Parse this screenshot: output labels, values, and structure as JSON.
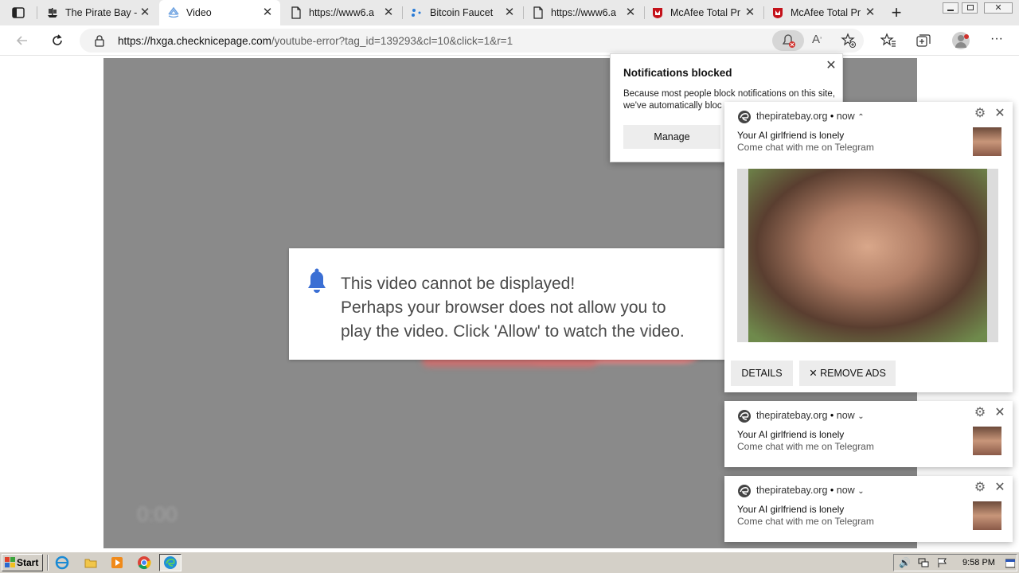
{
  "tabs": [
    {
      "title": "The Pirate Bay -",
      "icon": "pirate-ship-icon"
    },
    {
      "title": "Video",
      "icon": "edge-page-icon",
      "active": true
    },
    {
      "title": "https://www6.a",
      "icon": "page-icon"
    },
    {
      "title": "Bitcoin Faucet",
      "icon": "bitcoin-faucet-icon"
    },
    {
      "title": "https://www6.a",
      "icon": "page-icon"
    },
    {
      "title": "McAfee Total Pr",
      "icon": "mcafee-icon"
    },
    {
      "title": "McAfee Total Pr",
      "icon": "mcafee-icon"
    }
  ],
  "address": {
    "host": "https://hxga.checknicepage.com",
    "path": "/youtube-error?tag_id=139293&cl=10&click=1&r=1"
  },
  "video": {
    "time": "0:00"
  },
  "dialog": {
    "line1": "This video cannot be displayed!",
    "line2": "Perhaps your browser does not allow you to",
    "line3": "play the video. Click 'Allow' to watch the video."
  },
  "notif_blocked": {
    "title": "Notifications blocked",
    "desc_line1": "Because most people block notifications on this site,",
    "desc_line2": "we've automatically bloc",
    "manage": "Manage"
  },
  "toasts": [
    {
      "source": "thepiratebay.org",
      "time": "now",
      "chevron": "⌃",
      "line1": "Your AI girlfriend is lonely",
      "line2": "Come chat with me on Telegram"
    },
    {
      "source": "thepiratebay.org",
      "time": "now",
      "chevron": "⌄",
      "line1": "Your AI girlfriend is lonely",
      "line2": "Come chat with me on Telegram"
    },
    {
      "source": "thepiratebay.org",
      "time": "now",
      "chevron": "⌄",
      "line1": "Your AI girlfriend is lonely",
      "line2": "Come chat with me on Telegram"
    }
  ],
  "toast_buttons": {
    "details": "DETAILS",
    "remove_ads": "✕ REMOVE ADS"
  },
  "taskbar": {
    "start": "Start",
    "clock": "9:58 PM"
  },
  "colors": {
    "video_bg": "#8a8a8a",
    "bell": "#3b6fd4",
    "mcafee": "#c4121a"
  }
}
